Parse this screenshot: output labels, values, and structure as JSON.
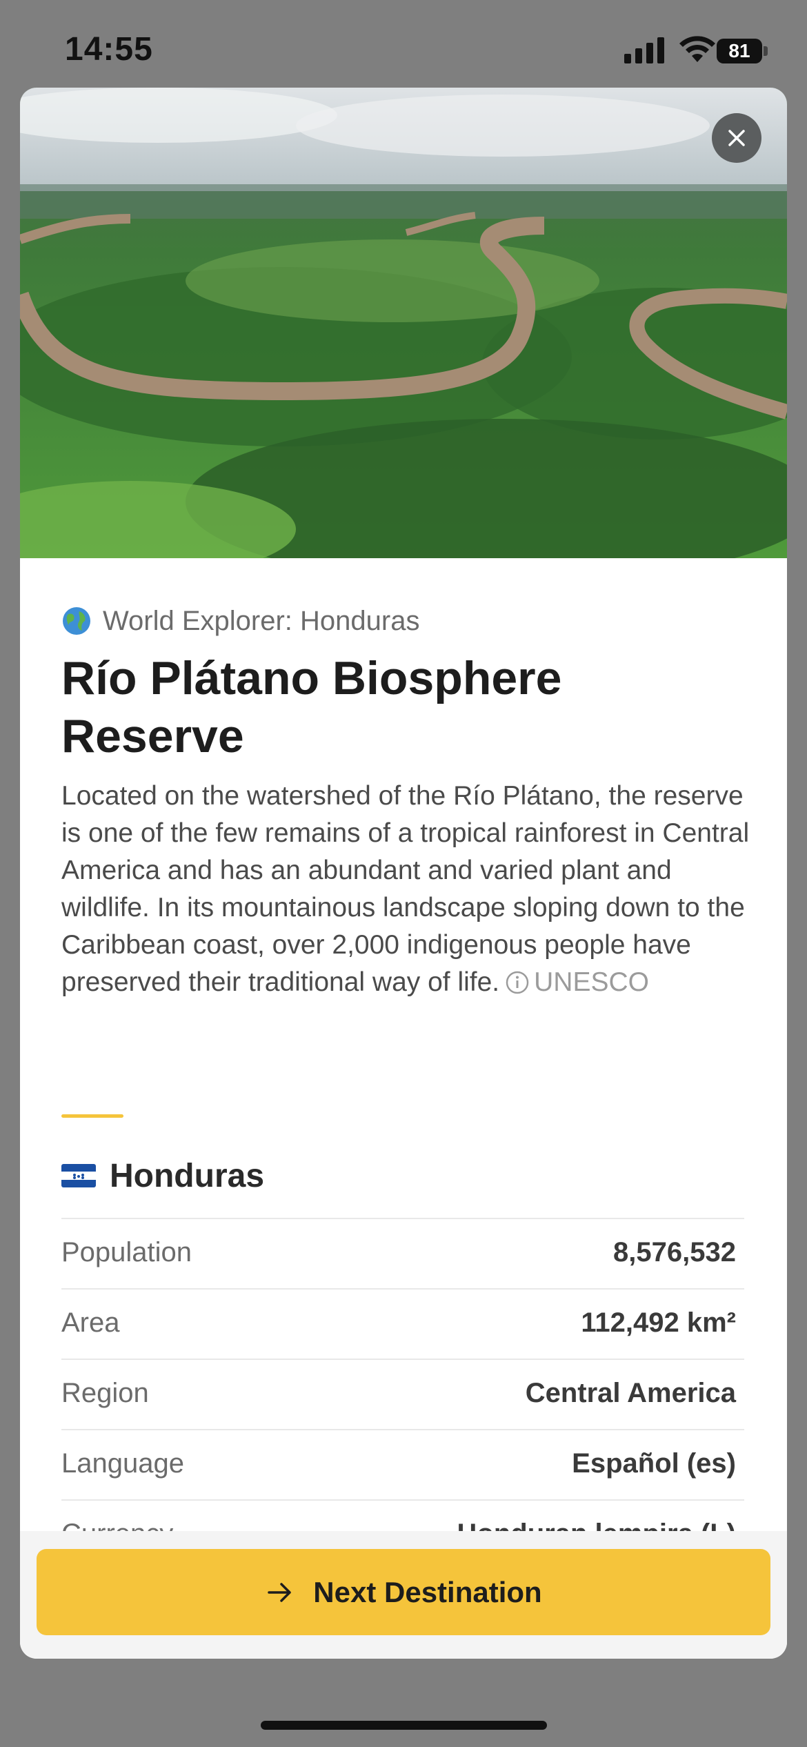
{
  "status_bar": {
    "time": "14:55",
    "battery": "81"
  },
  "header": {
    "icon": "globe-icon",
    "subtitle": "World Explorer: Honduras"
  },
  "title": "Río Plátano Biosphere Reserve",
  "description": {
    "text": "Located on the watershed of the Río Plátano, the reserve is one of the few remains of a tropical rainforest in Central America and has an abundant and varied plant and wildlife. In its mountainous landscape sloping down to the Caribbean coast, over 2,000 indigenous people have preserved their traditional way of life.",
    "source": "UNESCO",
    "source_icon": "info-icon"
  },
  "country": {
    "flag": "honduras-flag",
    "name": "Honduras",
    "stats": [
      {
        "label": "Population",
        "value": "8,576,532"
      },
      {
        "label": "Area",
        "value": "112,492 km²"
      },
      {
        "label": "Region",
        "value": "Central America"
      },
      {
        "label": "Language",
        "value": "Español (es)"
      },
      {
        "label": "Currency",
        "value": "Honduran lempira (L)"
      }
    ]
  },
  "footer": {
    "next_label": "Next Destination",
    "next_icon": "arrow-right-icon"
  },
  "colors": {
    "accent": "#f5c43b",
    "backdrop": "#7f7f7f"
  }
}
